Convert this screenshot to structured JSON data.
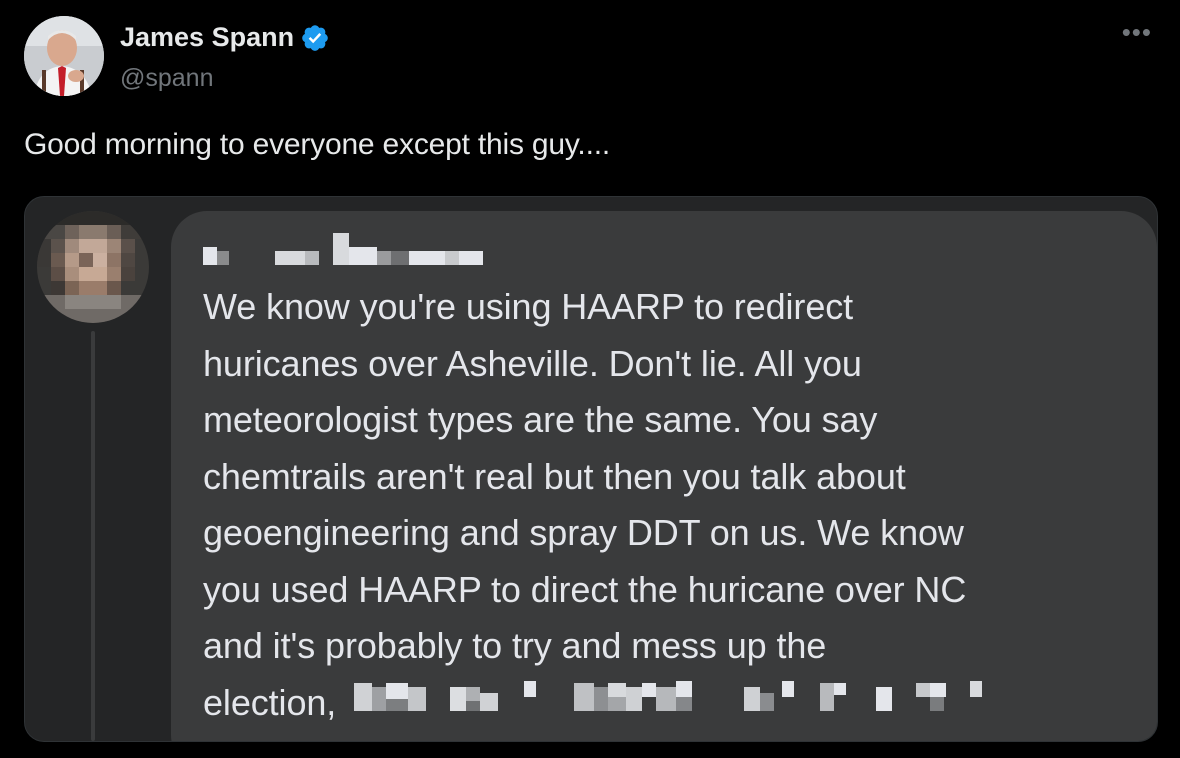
{
  "author": {
    "display_name": "James Spann",
    "handle": "@spann",
    "verified_icon": "verified-badge-icon",
    "avatar_icon": "avatar-photo"
  },
  "menu": {
    "more_label": "•••"
  },
  "tweet": {
    "text": "Good morning to everyone except this guy...."
  },
  "screenshot": {
    "commenter_avatar": "blurred-avatar",
    "commenter_name_redacted": true,
    "comment_lines": [
      "We know you're using HAARP to redirect",
      "huricanes over Asheville. Don't lie. All you",
      "meteorologist types are the same. You say",
      "chemtrails aren't real but then you talk about",
      "geoengineering and spray DDT on us. We know",
      "you used HAARP to direct the huricane over NC",
      "and it's probably to try and mess up the",
      "election,"
    ]
  },
  "colors": {
    "background": "#000000",
    "text_primary": "#e7e9ea",
    "text_secondary": "#71767b",
    "verified_blue": "#1d9bf0",
    "bubble": "#3a3b3c",
    "card": "#242526"
  }
}
